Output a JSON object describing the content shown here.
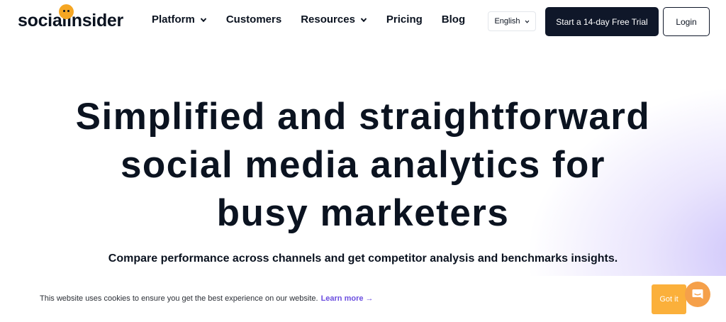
{
  "brand": {
    "name": "socialinsider",
    "accent": "#f5a623"
  },
  "nav": {
    "items": [
      {
        "label": "Platform",
        "has_dropdown": true
      },
      {
        "label": "Customers",
        "has_dropdown": false
      },
      {
        "label": "Resources",
        "has_dropdown": true
      },
      {
        "label": "Pricing",
        "has_dropdown": false
      },
      {
        "label": "Blog",
        "has_dropdown": false
      }
    ]
  },
  "header": {
    "language": "English",
    "trial_label": "Start a 14-day Free Trial",
    "login_label": "Login"
  },
  "hero": {
    "title_lines": [
      "Simplified and straightforward",
      "social media analytics for",
      "busy marketers"
    ],
    "subtitle": "Compare performance across channels and get competitor analysis and benchmarks insights."
  },
  "cookie": {
    "text": "This website uses cookies to ensure you get the best experience on our website.",
    "link": "Learn more →",
    "accept_label": "Got it"
  },
  "colors": {
    "dark": "#0f1729",
    "link": "#6c4fe0",
    "cookie_button": "#fbb03b",
    "chat": "#f5a04a"
  }
}
